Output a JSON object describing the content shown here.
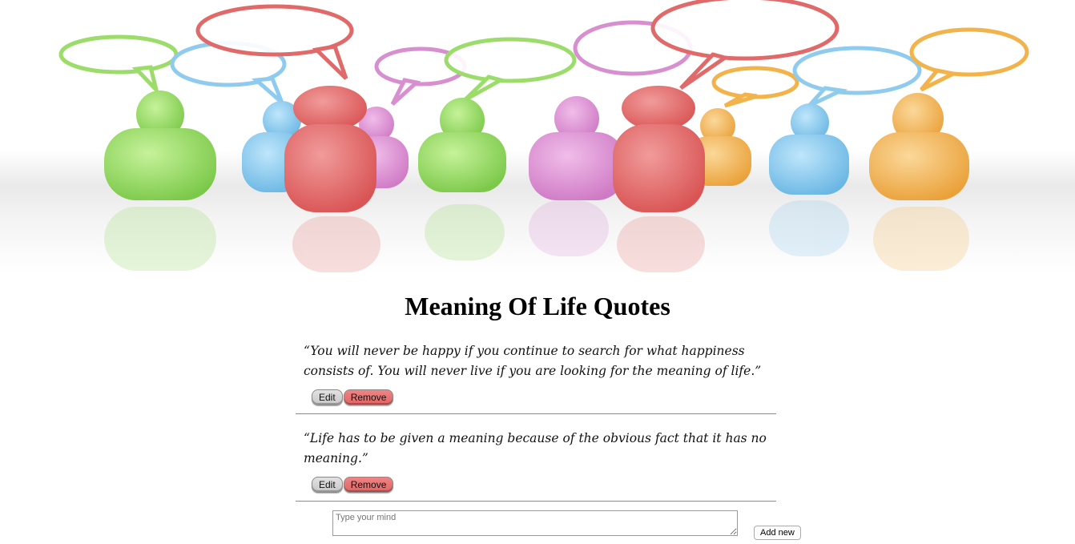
{
  "hero": {
    "image_alt": "Colorful figures with speech bubbles",
    "figure_colors": [
      "#8fd65a",
      "#7ec3ec",
      "#e36a6a",
      "#d58fd0",
      "#f2b34a"
    ]
  },
  "page": {
    "title": "Meaning Of Life Quotes"
  },
  "quotes": [
    {
      "text": "“You will never be happy if you continue to search for what happiness consists of. You will never live if you are looking for the meaning of life.”",
      "edit_label": "Edit",
      "remove_label": "Remove"
    },
    {
      "text": "“Life has to be given a meaning because of the obvious fact that it has no meaning.”",
      "edit_label": "Edit",
      "remove_label": "Remove"
    }
  ],
  "composer": {
    "value": "",
    "placeholder": "Type your mind",
    "add_label": "Add new"
  },
  "colors": {
    "remove_button": "#e36a6a",
    "edit_button": "#d4d4d4",
    "divider": "#8c8c8c"
  }
}
